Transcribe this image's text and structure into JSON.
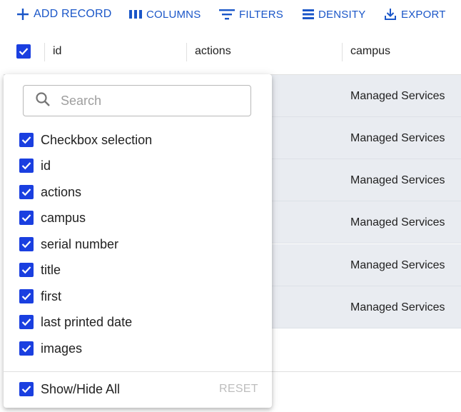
{
  "toolbar": {
    "add_record": "ADD RECORD",
    "columns": "COLUMNS",
    "filters": "FILTERS",
    "density": "DENSITY",
    "export": "EXPORT",
    "accent_color": "#1a56c8"
  },
  "grid": {
    "columns": [
      "id",
      "actions",
      "campus"
    ],
    "header_checkbox_checked": true,
    "rows": [
      {
        "campus": "Managed Services"
      },
      {
        "campus": "Managed Services"
      },
      {
        "campus": "Managed Services"
      },
      {
        "campus": "Managed Services"
      },
      {
        "campus": "Managed Services"
      },
      {
        "campus": "Managed Services"
      }
    ],
    "row_background": "#e9ecf1"
  },
  "column_panel": {
    "search_placeholder": "Search",
    "items": [
      {
        "label": "Checkbox selection",
        "checked": true
      },
      {
        "label": "id",
        "checked": true
      },
      {
        "label": "actions",
        "checked": true
      },
      {
        "label": "campus",
        "checked": true
      },
      {
        "label": "serial number",
        "checked": true
      },
      {
        "label": "title",
        "checked": true
      },
      {
        "label": "first",
        "checked": true
      },
      {
        "label": "last printed date",
        "checked": true
      },
      {
        "label": "images",
        "checked": true
      }
    ],
    "show_hide_all": "Show/Hide All",
    "reset": "RESET",
    "checkbox_color": "#1a3fe0"
  }
}
